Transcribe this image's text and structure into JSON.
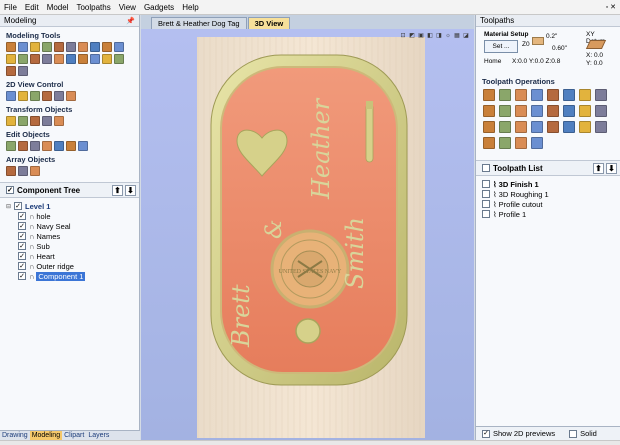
{
  "menu": [
    "File",
    "Edit",
    "Model",
    "Toolpaths",
    "View",
    "Gadgets",
    "Help"
  ],
  "left_panel": {
    "title": "Modeling",
    "sections": [
      {
        "label": "Modeling Tools",
        "icons": [
          "import-icon",
          "model-icon",
          "component-icon",
          "mirror-icon",
          "smooth-icon",
          "sculpt-icon",
          "shape-icon",
          "texture-icon",
          "weld-icon",
          "merge-icon",
          "fade-icon",
          "tilt-icon",
          "slice-icon",
          "bake-icon",
          "reset-icon",
          "wrap-icon",
          "distort-icon",
          "offset-icon",
          "create-icon",
          "zero-icon",
          "slab-icon",
          "vector-icon"
        ]
      },
      {
        "label": "2D View Control",
        "icons": [
          "zoom-fit-icon",
          "zoom-in-icon",
          "zoom-out-icon",
          "zoom-box-icon",
          "pan-icon",
          "refresh-icon"
        ]
      },
      {
        "label": "Transform Objects",
        "icons": [
          "move-icon",
          "scale-icon",
          "rotate-icon",
          "align-icon",
          "center-icon"
        ]
      },
      {
        "label": "Edit Objects",
        "icons": [
          "select-icon",
          "node-edit-icon",
          "group-icon",
          "ungroup-icon",
          "join-icon",
          "trim-icon",
          "delete-icon"
        ]
      },
      {
        "label": "Array Objects",
        "icons": [
          "grid-array-icon",
          "circular-array-icon",
          "copy-along-icon"
        ]
      }
    ],
    "tree_title": "Component Tree",
    "tree_root": "Level 1",
    "tree_items": [
      "hole",
      "Navy Seal",
      "Names",
      "Sub",
      "Heart",
      "Outer ridge",
      "Component 1"
    ],
    "bottom_tabs": [
      "Drawing",
      "Modeling",
      "Clipart",
      "Layers"
    ]
  },
  "center": {
    "tabs": [
      "Brett & Heather Dog Tag",
      "3D View"
    ],
    "tag": {
      "names": [
        "Brett",
        "&",
        "Heather",
        "Smith"
      ],
      "seal_text": "UNITED STATES NAVY"
    }
  },
  "right_panel": {
    "title": "Toolpaths",
    "material_setup": "Material Setup",
    "set_button": "Set ...",
    "thickness": "0.2\"",
    "z_label": "Z0",
    "offset_value": "0.60\"",
    "home_label": "Home",
    "home_coords": "X:0.0 Y:0.0 Z:0.8",
    "xy_datum": "XY Datum",
    "xy_coords": [
      "X: 0.0",
      "Y: 0.0"
    ],
    "operations_label": "Toolpath Operations",
    "list_title": "Toolpath List",
    "toolpaths": [
      "3D Finish 1",
      "3D Roughing 1",
      "Profile cutout",
      "Profile 1"
    ],
    "show_2d_previews": "Show 2D previews",
    "solid_label": "Solid"
  },
  "colors": {
    "accent": "#3b75d6",
    "tag_face": "#ec8a6a",
    "tag_rim": "#d8d38d",
    "background": "#a7b6e7"
  }
}
